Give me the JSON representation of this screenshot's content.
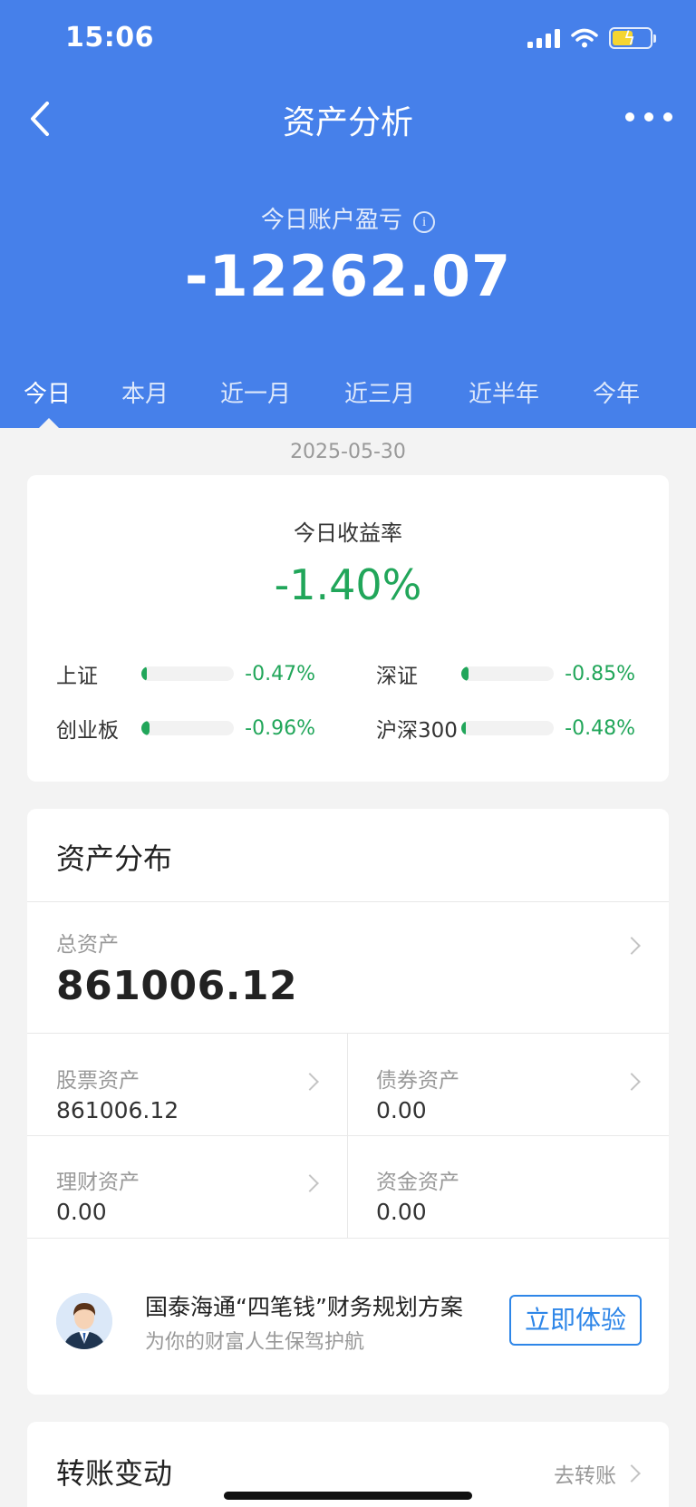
{
  "status_bar": {
    "time": "15:06"
  },
  "nav": {
    "title": "资产分析"
  },
  "summary": {
    "label": "今日账户盈亏",
    "value": "-12262.07"
  },
  "period_tabs": [
    {
      "label": "今日",
      "active": true
    },
    {
      "label": "本月",
      "active": false
    },
    {
      "label": "近一月",
      "active": false
    },
    {
      "label": "近三月",
      "active": false
    },
    {
      "label": "近半年",
      "active": false
    },
    {
      "label": "今年",
      "active": false
    }
  ],
  "date": "2025-05-30",
  "yield_card": {
    "label": "今日收益率",
    "value": "-1.40%",
    "indices": [
      {
        "name": "上证",
        "value": "-0.47%"
      },
      {
        "name": "深证",
        "value": "-0.85%"
      },
      {
        "name": "创业板",
        "value": "-0.96%"
      },
      {
        "name": "沪深300",
        "value": "-0.48%"
      }
    ]
  },
  "assets": {
    "title": "资产分布",
    "total_label": "总资产",
    "total_value": "861006.12",
    "items": [
      {
        "label": "股票资产",
        "value": "861006.12"
      },
      {
        "label": "债券资产",
        "value": "0.00"
      },
      {
        "label": "理财资产",
        "value": "0.00"
      },
      {
        "label": "资金资产",
        "value": "0.00"
      }
    ]
  },
  "promo": {
    "title": "国泰海通“四笔钱”财务规划方案",
    "subtitle": "为你的财富人生保驾护航",
    "button": "立即体验"
  },
  "transfer": {
    "title": "转账变动",
    "link": "去转账"
  },
  "colors": {
    "header": "#4680ea",
    "negative": "#21a65a",
    "accent": "#2e86e8"
  }
}
